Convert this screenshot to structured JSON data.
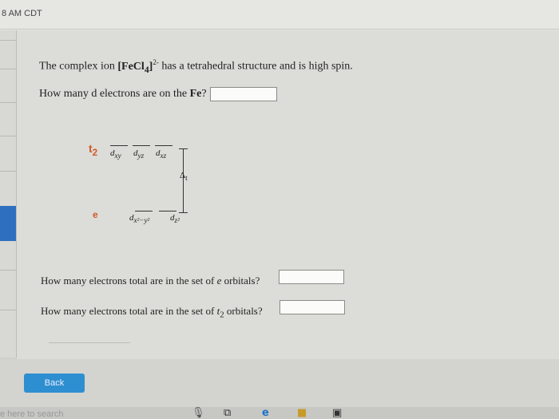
{
  "status_bar": {
    "clock": "8 AM CDT"
  },
  "question": {
    "prompt_pre": "The complex ion ",
    "ion": "[FeCl",
    "ion_sub": "4",
    "ion_close": "]",
    "ion_charge": "2-",
    "prompt_post": " has a tetrahedral structure and is high spin.",
    "q_d_electrons_pre": "How many d electrons are on the ",
    "q_d_electrons_bold": "Fe",
    "q_d_electrons_post": "?",
    "q_e_orbitals_pre": "How many electrons total are in the set of ",
    "q_e_orbitals_ital": "e",
    "q_e_orbitals_post": " orbitals?",
    "q_t2_orbitals_pre": "How many electrons total are in the set of ",
    "q_t2_orbitals_ital": "t",
    "q_t2_orbitals_sub": "2",
    "q_t2_orbitals_post": " orbitals?",
    "answers": {
      "d_electrons": "",
      "e_electrons": "",
      "t2_electrons": ""
    }
  },
  "diagram": {
    "t2_label": "t",
    "t2_sub": "2",
    "t2_orbitals": [
      "d",
      "d",
      "d"
    ],
    "t2_orbital_subs": [
      "xy",
      "yz",
      "xz"
    ],
    "e_label": "e",
    "e_orbital_1": "d",
    "e_orbital_1_sub": "x²−y²",
    "e_orbital_2": "d",
    "e_orbital_2_sub": "z²",
    "delta": "Δ",
    "delta_sub": "t"
  },
  "footer": {
    "back_label": "Back"
  },
  "taskbar": {
    "search_hint": "e here to search"
  }
}
